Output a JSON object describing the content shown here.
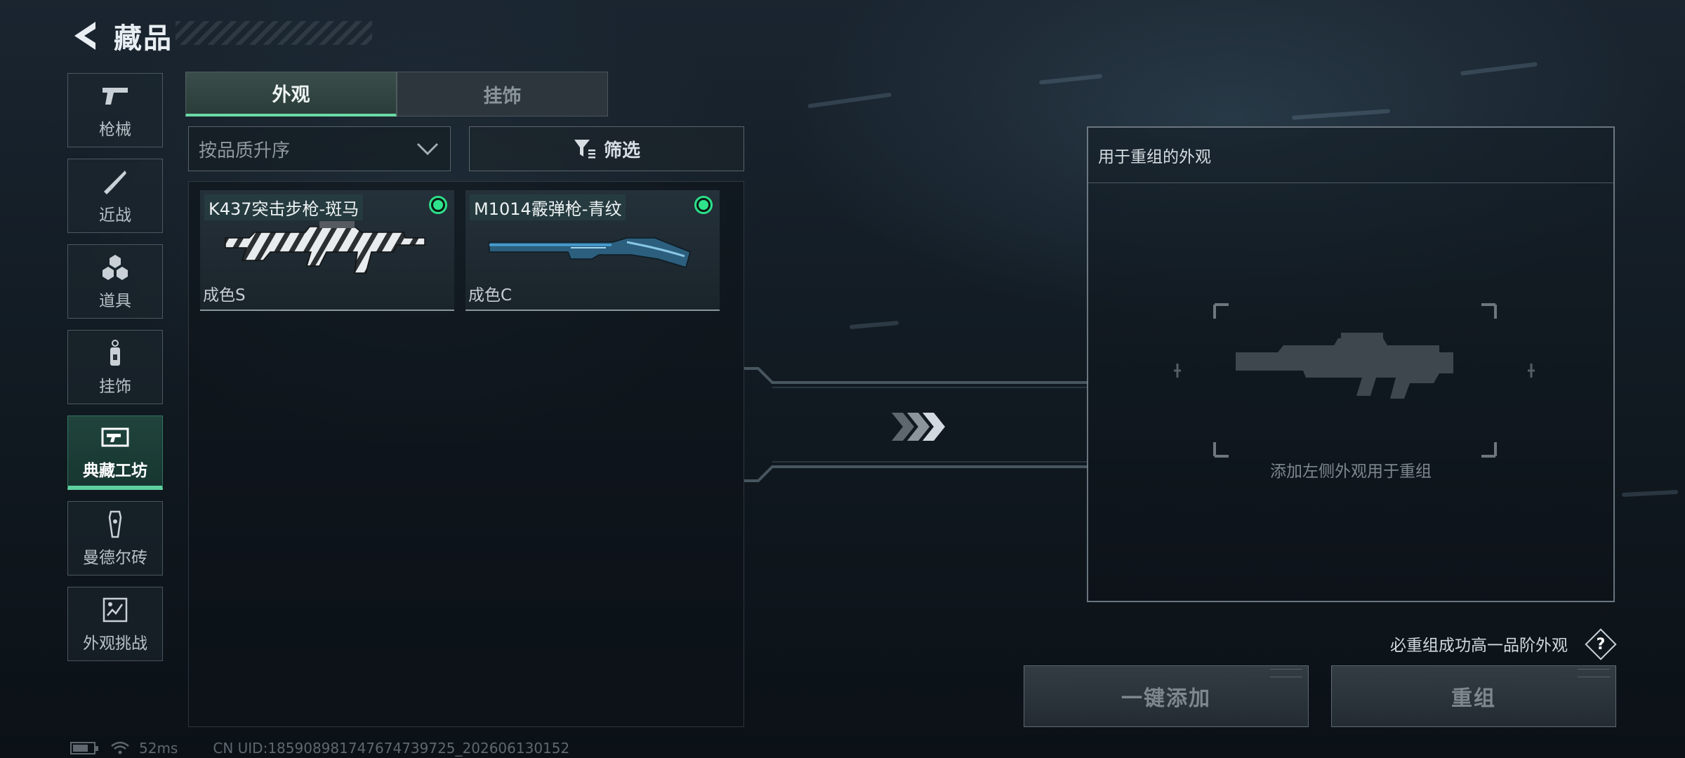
{
  "header": {
    "title": "藏品"
  },
  "nav": {
    "items": [
      {
        "label": "枪械",
        "icon": "pistol-icon",
        "active": false
      },
      {
        "label": "近战",
        "icon": "knife-icon",
        "active": false
      },
      {
        "label": "道具",
        "icon": "grenades-icon",
        "active": false
      },
      {
        "label": "挂饰",
        "icon": "charm-icon",
        "active": false
      },
      {
        "label": "典藏工坊",
        "icon": "workshop-icon",
        "active": true
      },
      {
        "label": "曼德尔砖",
        "icon": "brick-icon",
        "active": false
      },
      {
        "label": "外观挑战",
        "icon": "challenge-icon",
        "active": false
      }
    ]
  },
  "tabs": [
    {
      "label": "外观",
      "active": true
    },
    {
      "label": "挂饰",
      "active": false
    }
  ],
  "sort": {
    "label": "按品质升序"
  },
  "filter": {
    "label": "筛选"
  },
  "inventory": {
    "items": [
      {
        "name": "K437突击步枪-斑马",
        "grade": "成色S",
        "selected": true
      },
      {
        "name": "M1014霰弹枪-青纹",
        "grade": "成色C",
        "selected": true
      }
    ]
  },
  "reassemble": {
    "title": "用于重组的外观",
    "hint": "添加左侧外观用于重组",
    "note": "必重组成功高一品阶外观",
    "help_label": "?",
    "add_all_label": "一键添加",
    "reassemble_label": "重组"
  },
  "status": {
    "ping": "52ms",
    "uid": "CN UID:18590898174767473972​5_202606130152",
    "battery_level": 0.75
  },
  "colors": {
    "accent": "#5fd19f",
    "selected_dot": "#2fe38d"
  }
}
